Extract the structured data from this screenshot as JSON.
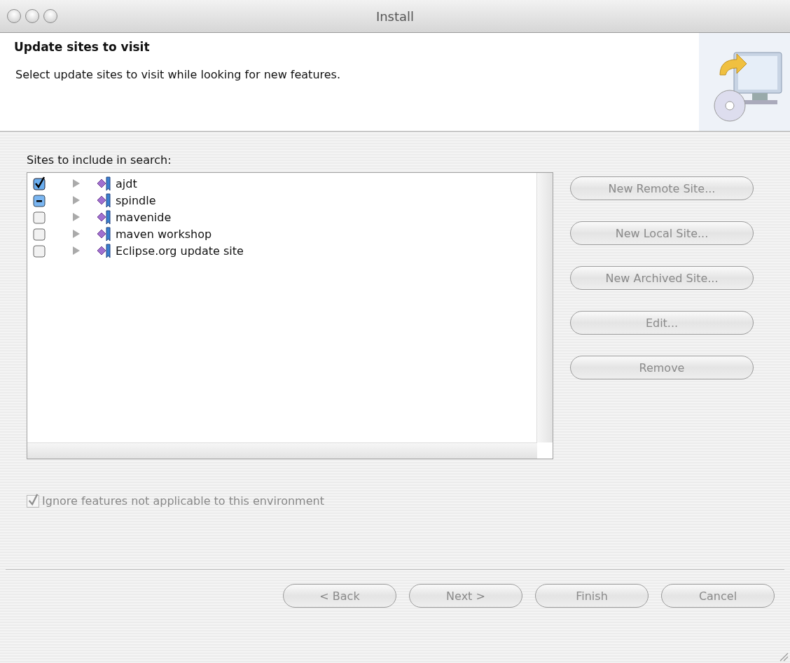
{
  "window": {
    "title": "Install"
  },
  "header": {
    "title": "Update sites to visit",
    "description": "Select update sites to visit while looking for new features."
  },
  "sites_label": "Sites to include in search:",
  "sites": [
    {
      "name": "ajdt",
      "checked": true,
      "partial": false,
      "expanded": false
    },
    {
      "name": "spindle",
      "checked": false,
      "partial": true,
      "expanded": false
    },
    {
      "name": "mavenide",
      "checked": false,
      "partial": false,
      "expanded": false
    },
    {
      "name": "maven workshop",
      "checked": false,
      "partial": false,
      "expanded": false
    },
    {
      "name": "Eclipse.org update site",
      "checked": false,
      "partial": false,
      "expanded": false
    }
  ],
  "site_buttons": [
    {
      "label": "New Remote Site...",
      "disabled": true
    },
    {
      "label": "New Local Site...",
      "disabled": true
    },
    {
      "label": "New Archived Site...",
      "disabled": true
    },
    {
      "label": "Edit...",
      "disabled": true
    },
    {
      "label": "Remove",
      "disabled": true
    }
  ],
  "ignore_option": {
    "label": "Ignore features not applicable to this environment",
    "checked": true,
    "disabled": true
  },
  "footer_buttons": [
    {
      "label": "< Back",
      "disabled": true
    },
    {
      "label": "Next >",
      "disabled": true
    },
    {
      "label": "Finish",
      "disabled": true
    },
    {
      "label": "Cancel",
      "disabled": true
    }
  ]
}
